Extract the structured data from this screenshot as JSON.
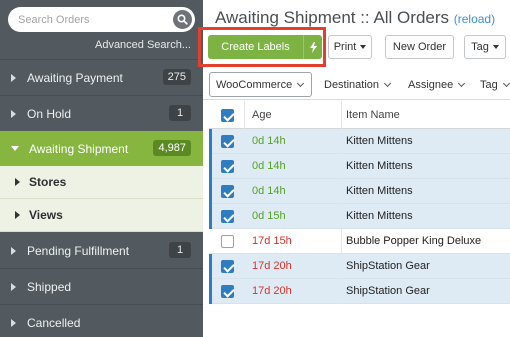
{
  "sidebar": {
    "search": {
      "placeholder": "Search Orders"
    },
    "advanced_search": "Advanced Search...",
    "items": [
      {
        "label": "Awaiting Payment",
        "count": "275"
      },
      {
        "label": "On Hold",
        "count": "1"
      },
      {
        "label": "Awaiting Shipment",
        "count": "4,987"
      }
    ],
    "sub_items": [
      {
        "label": "Stores"
      },
      {
        "label": "Views"
      }
    ],
    "items_after": [
      {
        "label": "Pending Fulfillment",
        "count": "1"
      },
      {
        "label": "Shipped"
      },
      {
        "label": "Cancelled"
      }
    ]
  },
  "header": {
    "title": "Awaiting Shipment :: All Orders",
    "reload": "(reload)"
  },
  "toolbar": {
    "create_labels": "Create Labels",
    "print": "Print",
    "new_order": "New Order",
    "tag": "Tag"
  },
  "filters": {
    "store": "WooCommerce",
    "destination": "Destination",
    "assignee": "Assignee",
    "tag": "Tag"
  },
  "table": {
    "columns": {
      "age": "Age",
      "item_name": "Item Name"
    },
    "rows": [
      {
        "age": "0d 14h",
        "item": "Kitten Mittens"
      },
      {
        "age": "0d 14h",
        "item": "Kitten Mittens"
      },
      {
        "age": "0d 14h",
        "item": "Kitten Mittens"
      },
      {
        "age": "0d 15h",
        "item": "Kitten Mittens"
      },
      {
        "age": "17d 15h",
        "item": "Bubble Popper King Deluxe"
      },
      {
        "age": "17d 20h",
        "item": "ShipStation Gear"
      },
      {
        "age": "17d 20h",
        "item": "ShipStation Gear"
      }
    ]
  },
  "colors": {
    "sidebar_bg": "#525a5f",
    "active_green": "#86b640",
    "primary_button": "#7cb342",
    "selection_blue": "#2f7dc0",
    "age_recent": "#52a321",
    "age_old": "#d9322a",
    "highlight_red": "#e1402e"
  }
}
